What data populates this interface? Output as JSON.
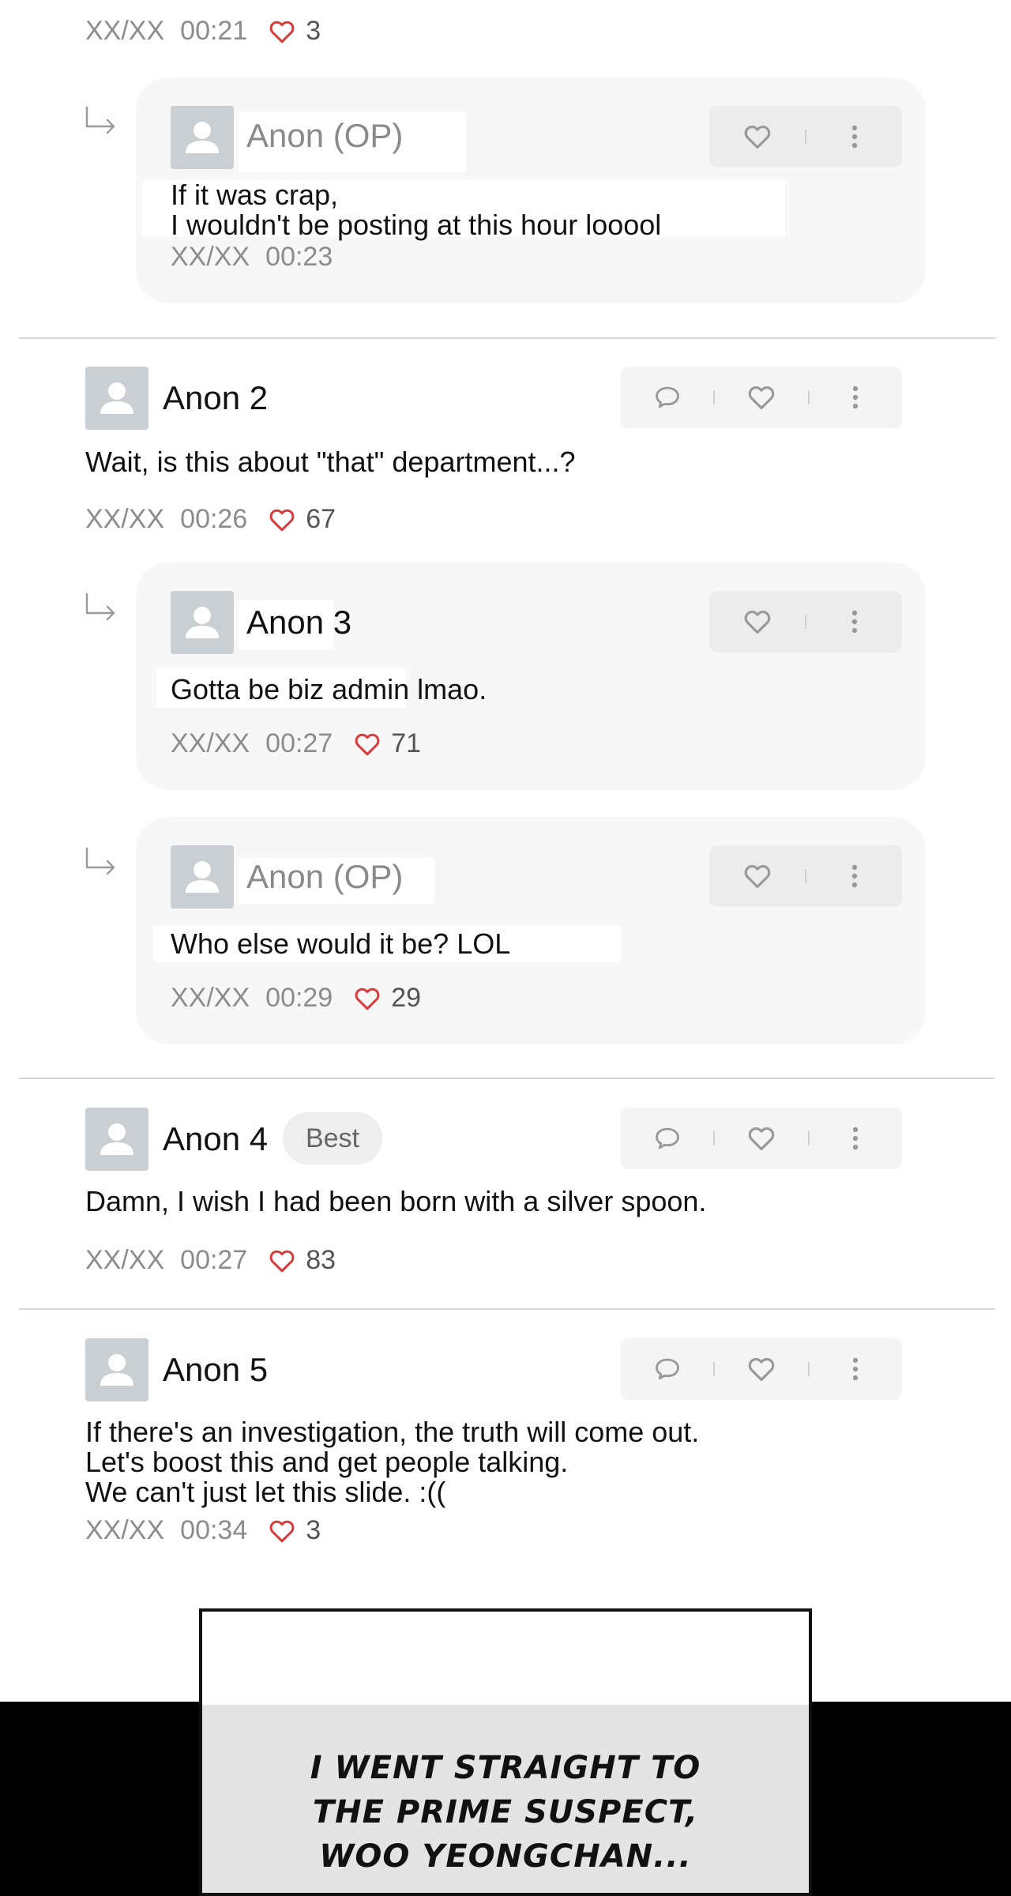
{
  "icons": {
    "like": "heart-outline-icon",
    "reply": "speech-bubble-icon",
    "more": "vertical-dots-icon",
    "thread": "reply-arrow-icon",
    "avatar": "default-user-icon"
  },
  "colors": {
    "heart": "#d93a3a",
    "meta_text": "#8c8c8c",
    "op_name": "#8a8a8a",
    "card_bg": "#f7f7f7",
    "panel_band": "#000000"
  },
  "thread": {
    "top_meta": {
      "date": "XX/XX",
      "time": "00:21",
      "likes": "3"
    },
    "reply_op_1": {
      "author": "Anon (OP)",
      "lines": [
        "If it was crap,",
        "I wouldn't be posting at this hour looool"
      ],
      "date": "XX/XX",
      "time": "00:23"
    },
    "comment_2": {
      "author": "Anon 2",
      "text": "Wait, is this about \"that\" department...?",
      "date": "XX/XX",
      "time": "00:26",
      "likes": "67"
    },
    "reply_3": {
      "author": "Anon 3",
      "text": "Gotta be biz admin lmao.",
      "date": "XX/XX",
      "time": "00:27",
      "likes": "71"
    },
    "reply_op_2": {
      "author": "Anon (OP)",
      "text": "Who else would it be? LOL",
      "date": "XX/XX",
      "time": "00:29",
      "likes": "29"
    },
    "comment_4": {
      "author": "Anon 4",
      "badge": "Best",
      "text": "Damn, I wish I had been born with a silver spoon.",
      "date": "XX/XX",
      "time": "00:27",
      "likes": "83"
    },
    "comment_5": {
      "author": "Anon 5",
      "lines": [
        "If there's an investigation, the truth will come out.",
        "Let's boost this and get people talking.",
        "We can't just let this slide. :(("
      ],
      "date": "XX/XX",
      "time": "00:34",
      "likes": "3"
    }
  },
  "panel": {
    "lines": [
      "I WENT STRAIGHT TO",
      "THE PRIME SUSPECT,",
      "WOO YEONGCHAN..."
    ]
  }
}
